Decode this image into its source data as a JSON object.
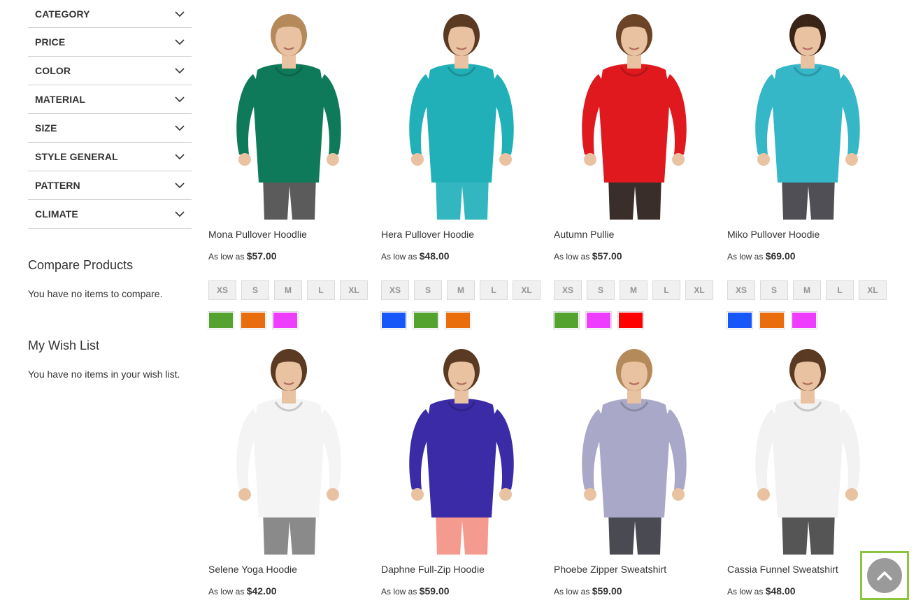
{
  "filters": [
    "CATEGORY",
    "PRICE",
    "COLOR",
    "MATERIAL",
    "SIZE",
    "STYLE GENERAL",
    "PATTERN",
    "CLIMATE"
  ],
  "compare": {
    "title": "Compare Products",
    "empty": "You have no items to compare."
  },
  "wishlist": {
    "title": "My Wish List",
    "empty": "You have no items in your wish list."
  },
  "price_prefix": "As low as",
  "size_options": [
    "XS",
    "S",
    "M",
    "L",
    "XL"
  ],
  "colors": {
    "green": "#53a32e",
    "orange": "#e96d0c",
    "purple": "#ef3dff",
    "blue": "#1857f7",
    "red": "#ff0000",
    "highlight": "#8cc63f"
  },
  "products": [
    {
      "name": "Mona Pullover Hoodlie",
      "price": "$57.00",
      "swatches": [
        "green",
        "orange",
        "purple"
      ],
      "garment": "#0f7a5a",
      "bottom": "#5b5b5b",
      "hair": "#b48a5a"
    },
    {
      "name": "Hera Pullover Hoodie",
      "price": "$48.00",
      "swatches": [
        "blue",
        "green",
        "orange"
      ],
      "garment": "#22b0b8",
      "bottom": "#33b6c0",
      "hair": "#5a3a22"
    },
    {
      "name": "Autumn Pullie",
      "price": "$57.00",
      "swatches": [
        "green",
        "purple",
        "red"
      ],
      "garment": "#e0191f",
      "bottom": "#3a2e2a",
      "hair": "#6b4428"
    },
    {
      "name": "Miko Pullover Hoodie",
      "price": "$69.00",
      "swatches": [
        "blue",
        "orange",
        "purple"
      ],
      "garment": "#35b7c8",
      "bottom": "#4f4f55",
      "hair": "#3a2418"
    },
    {
      "name": "Selene Yoga Hoodie",
      "price": "$42.00",
      "swatches": [],
      "garment": "#f4f4f4",
      "bottom": "#8a8a8a",
      "hair": "#5a3a22"
    },
    {
      "name": "Daphne Full-Zip Hoodie",
      "price": "$59.00",
      "swatches": [],
      "garment": "#3b2ba6",
      "bottom": "#f49a8f",
      "hair": "#5a3a22"
    },
    {
      "name": "Phoebe Zipper Sweatshirt",
      "price": "$59.00",
      "swatches": [],
      "garment": "#a9a8c8",
      "bottom": "#4a4a52",
      "hair": "#b48a5a"
    },
    {
      "name": "Cassia Funnel Sweatshirt",
      "price": "$48.00",
      "swatches": [],
      "garment": "#f2f2f2",
      "bottom": "#555555",
      "hair": "#5a3a22"
    }
  ],
  "back_to_top_icon": "chevron-up-icon"
}
